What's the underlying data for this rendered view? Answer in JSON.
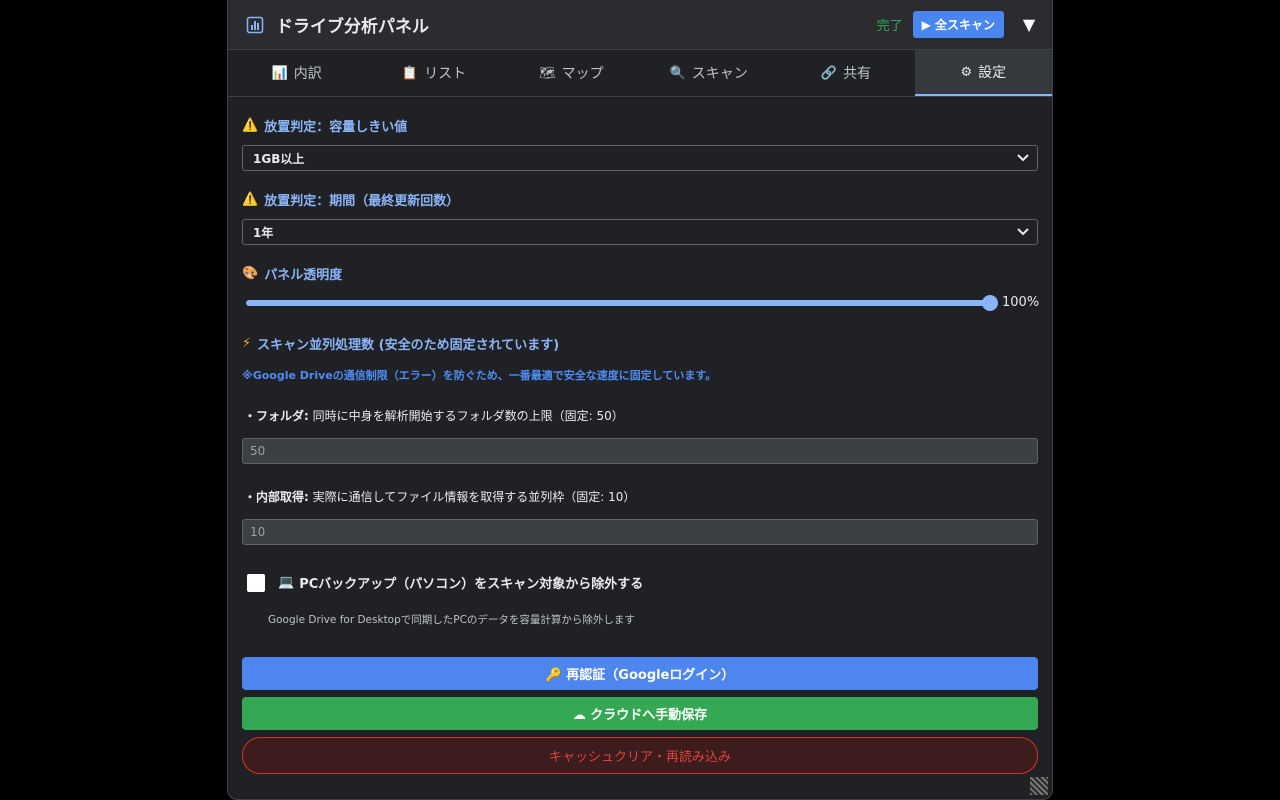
{
  "header": {
    "title": "ドライブ分析パネル",
    "status": "完了",
    "scan_button": "▶ 全スキャン",
    "collapse_glyph": "▼"
  },
  "tabs": [
    {
      "icon": "📊",
      "label": "内訳"
    },
    {
      "icon": "📋",
      "label": "リスト"
    },
    {
      "icon": "🗺",
      "label": "マップ"
    },
    {
      "icon": "🔍",
      "label": "スキャン"
    },
    {
      "icon": "🔗",
      "label": "共有"
    },
    {
      "icon": "⚙",
      "label": "設定",
      "active": true
    }
  ],
  "settings": {
    "size_threshold": {
      "icon": "⚠️",
      "label": "放置判定：容量しきい値",
      "value": "1GB以上"
    },
    "period": {
      "icon": "⚠️",
      "label": "放置判定：期間（最終更新回数）",
      "value": "1年"
    },
    "opacity": {
      "icon": "🎨",
      "label": "パネル透明度",
      "value_text": "100%",
      "value": 1.0
    },
    "concurrency": {
      "icon": "⚡",
      "label": "スキャン並列処理数 (安全のため固定されています)",
      "note": "※Google Driveの通信制限（エラー）を防ぐため、一番最適で安全な速度に固定しています。",
      "folder_label_bold": "・フォルダ:",
      "folder_label_rest": " 同時に中身を解析開始するフォルダ数の上限（固定: 50）",
      "folder_value": "50",
      "internal_label_bold": "・内部取得:",
      "internal_label_rest": " 実際に通信してファイル情報を取得する並列枠（固定: 10）",
      "internal_value": "10"
    },
    "exclude_pc": {
      "icon": "💻",
      "label": "PCバックアップ（パソコン）をスキャン対象から除外する",
      "hint": "Google Drive for Desktopで同期したPCのデータを容量計算から除外します",
      "checked": false
    }
  },
  "buttons": {
    "reauth": "🔑 再認証（Googleログイン）",
    "cloud_save": "☁ クラウドへ手動保存",
    "clear_cache": "キャッシュクリア・再読み込み"
  },
  "colors": {
    "accent": "#8ab4f8",
    "primary_button": "#4e86f0",
    "success": "#34a853",
    "danger": "#d93025"
  }
}
